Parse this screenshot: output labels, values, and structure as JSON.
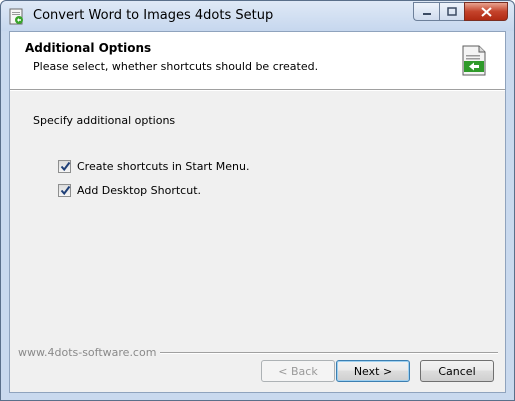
{
  "window": {
    "title": "Convert Word to Images 4dots Setup",
    "caption_buttons": [
      "minimize",
      "maximize",
      "close"
    ]
  },
  "header": {
    "title": "Additional Options",
    "subtitle": "Please select, whether shortcuts should be created."
  },
  "main": {
    "section_label": "Specify additional options",
    "options": [
      {
        "label": "Create shortcuts in Start Menu.",
        "checked": true
      },
      {
        "label": "Add Desktop Shortcut.",
        "checked": true
      }
    ]
  },
  "footer": {
    "brand": "www.4dots-software.com",
    "back_label": "< Back",
    "next_label": "Next >",
    "cancel_label": "Cancel"
  }
}
